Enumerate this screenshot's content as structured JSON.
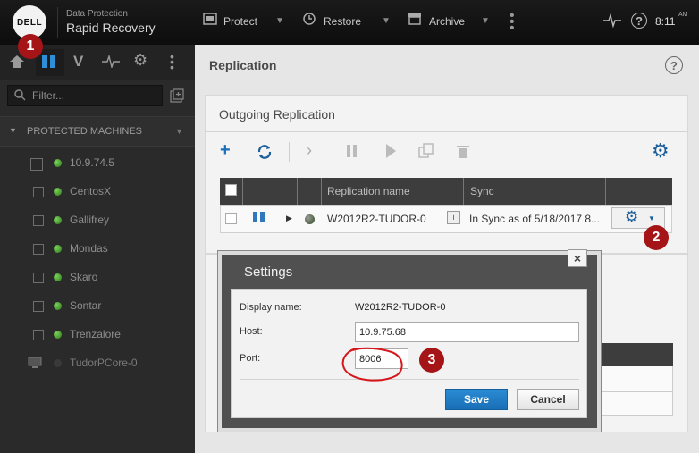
{
  "header": {
    "brand_logo": "DELL",
    "brand_sub": "Data Protection",
    "brand_main": "Rapid Recovery",
    "nav": [
      {
        "label": "Protect",
        "icon": "protect-icon"
      },
      {
        "label": "Restore",
        "icon": "restore-icon"
      },
      {
        "label": "Archive",
        "icon": "archive-icon"
      }
    ],
    "time": "8:11",
    "ampm": "AM"
  },
  "sidebar": {
    "filter_placeholder": "Filter...",
    "section_title": "PROTECTED MACHINES",
    "machines": [
      {
        "name": "10.9.74.5"
      },
      {
        "name": "CentosX"
      },
      {
        "name": "Gallifrey"
      },
      {
        "name": "Mondas"
      },
      {
        "name": "Skaro"
      },
      {
        "name": "Sontar"
      },
      {
        "name": "Trenzalore"
      },
      {
        "name": "TudorPCore-0"
      }
    ]
  },
  "main": {
    "title": "Replication",
    "section_title": "Outgoing Replication",
    "table": {
      "columns": [
        "Replication name",
        "Sync"
      ],
      "row": {
        "name": "W2012R2-TUDOR-0",
        "sync": "In Sync as of 5/18/2017 8..."
      }
    }
  },
  "modal": {
    "title": "Settings",
    "close_label": "×",
    "display_name_label": "Display name:",
    "display_name_value": "W2012R2-TUDOR-0",
    "host_label": "Host:",
    "host_value": "10.9.75.68",
    "port_label": "Port:",
    "port_value": "8006",
    "save_label": "Save",
    "cancel_label": "Cancel"
  },
  "annotations": {
    "marker1": "1",
    "marker2": "2",
    "marker3": "3",
    "accent_color": "#a51417"
  }
}
